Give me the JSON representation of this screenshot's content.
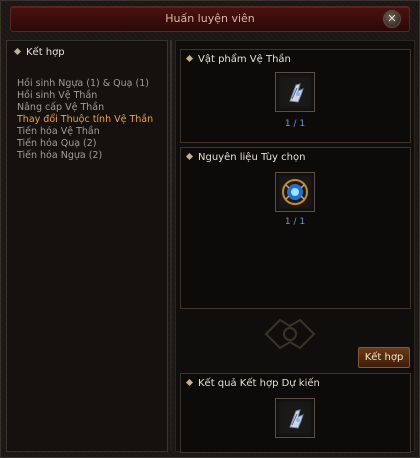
{
  "window": {
    "title": "Huấn luyện viên",
    "close_glyph": "✕"
  },
  "left_panel": {
    "header": "Kết hợp",
    "items": [
      {
        "label": "Hồi sinh Ngựa (1) & Quạ (1)"
      },
      {
        "label": "Hồi sinh Vệ Thần"
      },
      {
        "label": "Nâng cấp Vệ Thần"
      },
      {
        "label": "Thay đổi Thuộc tính Vệ Thần",
        "active": true
      },
      {
        "label": "Tiến hóa Vệ Thần"
      },
      {
        "label": "Tiến hóa Quạ (2)"
      },
      {
        "label": "Tiến hóa Ngựa (2)"
      }
    ]
  },
  "sections": {
    "item": {
      "title": "Vật phẩm Vệ Thần",
      "count": "1 / 1",
      "icon": "gauntlet-icon"
    },
    "material": {
      "title": "Nguyên liệu Tùy chọn",
      "count": "1 / 1",
      "icon": "blue-orb-icon"
    },
    "result": {
      "title": "Kết quả Kết hợp Dự kiến",
      "icon": "gauntlet-icon"
    }
  },
  "buttons": {
    "combine": "Kết hợp"
  },
  "colors": {
    "active_item": "#f0a238",
    "count": "#6f96d6",
    "title_bar": "#4a1210"
  }
}
